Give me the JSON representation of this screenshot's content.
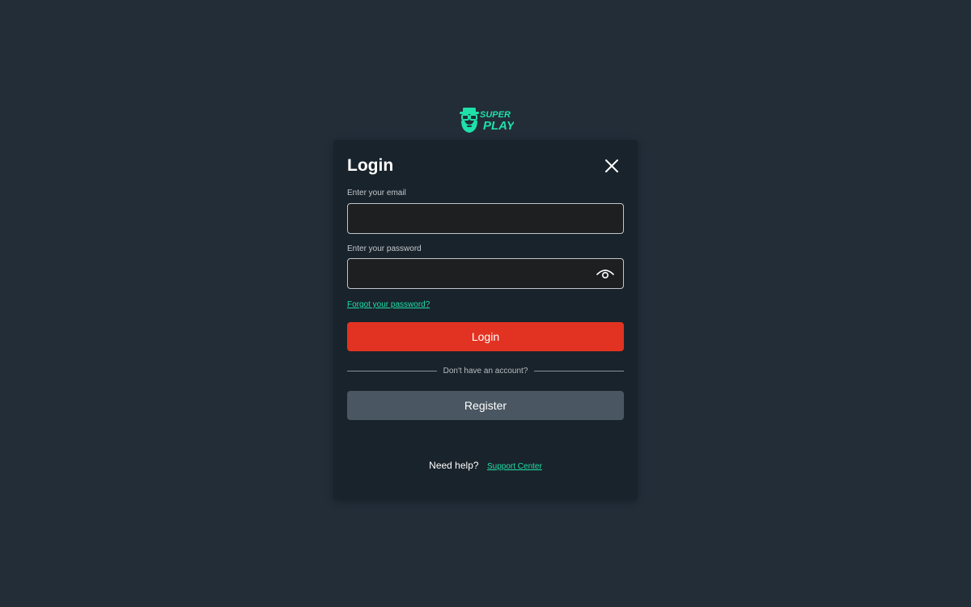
{
  "brand": {
    "logo_top": "SUPER",
    "logo_bottom": "PLAY",
    "accent_color": "#1fe0a8"
  },
  "modal": {
    "title": "Login",
    "close_icon": "close-icon"
  },
  "email": {
    "label": "Enter your email",
    "value": "",
    "placeholder": ""
  },
  "password": {
    "label": "Enter your password",
    "value": "",
    "placeholder": "",
    "toggle_icon": "eye-icon"
  },
  "forgot_password": "Forgot your password?",
  "login_button": {
    "label": "Login",
    "color": "#e23322"
  },
  "divider_text": "Don't have an account?",
  "register_button": {
    "label": "Register",
    "color": "#4a5762"
  },
  "help": {
    "text": "Need help?",
    "link": "Support Center"
  }
}
